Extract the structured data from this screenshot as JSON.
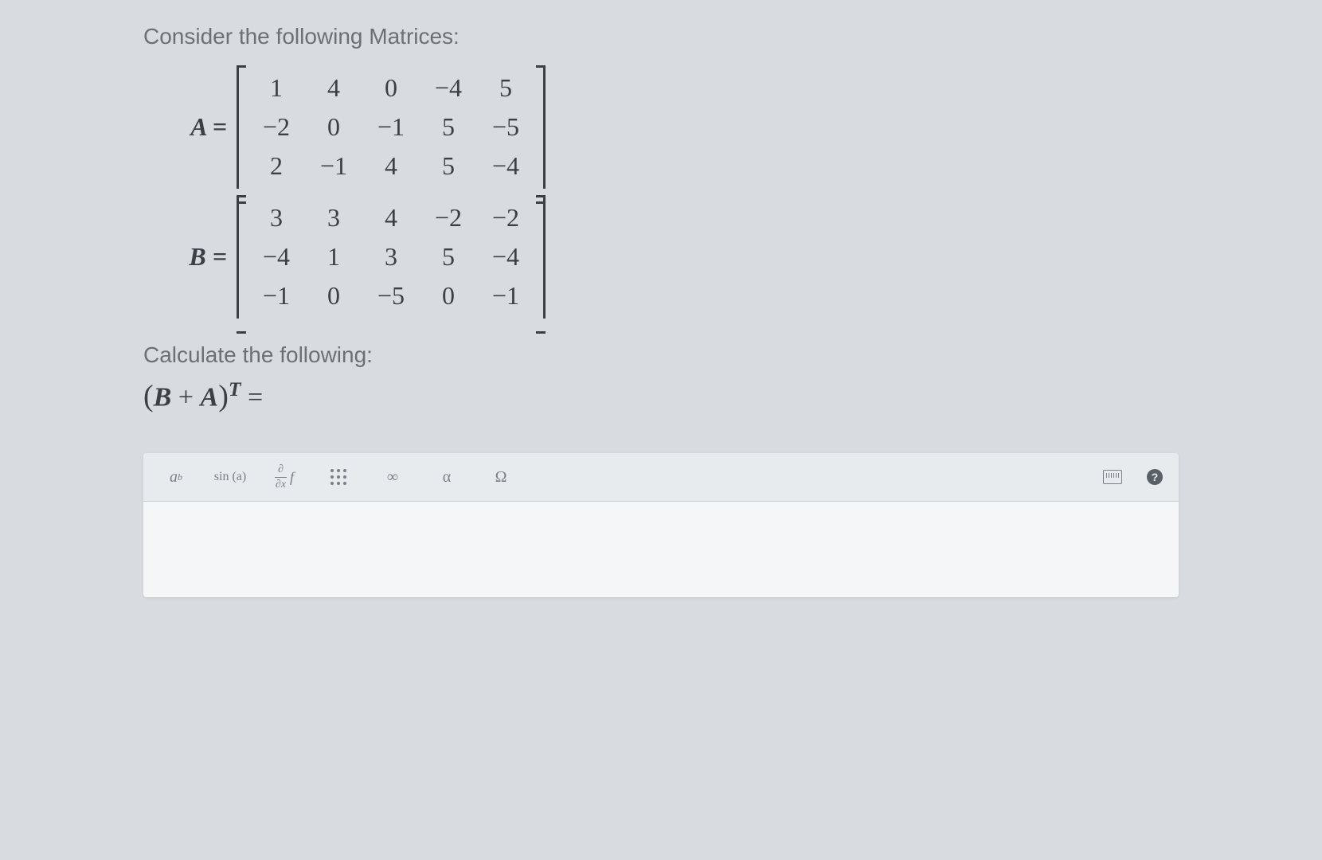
{
  "prompt1": "Consider the following Matrices:",
  "matrixA": {
    "label": "A =",
    "rows": [
      [
        "1",
        "4",
        "0",
        "−4",
        "5"
      ],
      [
        "−2",
        "0",
        "−1",
        "5",
        "−5"
      ],
      [
        "2",
        "−1",
        "4",
        "5",
        "−4"
      ]
    ]
  },
  "matrixB": {
    "label": "B =",
    "rows": [
      [
        "3",
        "3",
        "4",
        "−2",
        "−2"
      ],
      [
        "−4",
        "1",
        "3",
        "5",
        "−4"
      ],
      [
        "−1",
        "0",
        "−5",
        "0",
        "−1"
      ]
    ]
  },
  "prompt2": "Calculate the following:",
  "formula": {
    "lparen": "(",
    "varB": "B",
    "plus": " + ",
    "varA": "A",
    "rparen": ")",
    "sup": "T",
    "eq": " ="
  },
  "toolbar": {
    "power": "a",
    "power_sup": "b",
    "sin": "sin (a)",
    "frac_top": "∂",
    "frac_bot": "∂x",
    "frac_side": "f",
    "infinity": "∞",
    "alpha": "α",
    "omega": "Ω",
    "help": "?"
  }
}
